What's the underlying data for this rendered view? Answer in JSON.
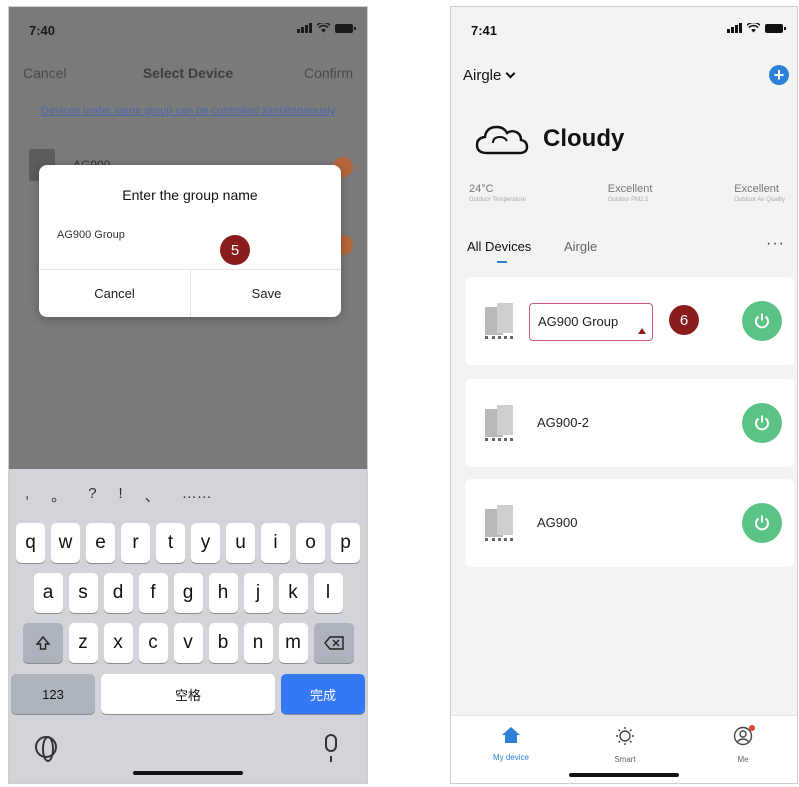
{
  "left": {
    "status": {
      "time": "7:40"
    },
    "nav": {
      "cancel": "Cancel",
      "title": "Select Device",
      "confirm": "Confirm"
    },
    "hint": "Devices under same group can be controlled simultaneously",
    "background_devices": [
      {
        "name": "AG900"
      }
    ],
    "dialog": {
      "title": "Enter the group name",
      "input_value": "AG900 Group",
      "cancel_label": "Cancel",
      "save_label": "Save"
    },
    "step_badge": "5",
    "keyboard": {
      "suggestions": [
        ",",
        "。",
        "?",
        "!",
        "、",
        "……"
      ],
      "row1": [
        "q",
        "w",
        "e",
        "r",
        "t",
        "y",
        "u",
        "i",
        "o",
        "p"
      ],
      "row2": [
        "a",
        "s",
        "d",
        "f",
        "g",
        "h",
        "j",
        "k",
        "l"
      ],
      "row3": [
        "z",
        "x",
        "c",
        "v",
        "b",
        "n",
        "m"
      ],
      "shift_icon": "shift-icon",
      "delete_icon": "backspace-icon",
      "numbers_label": "123",
      "space_label": "空格",
      "done_label": "完成",
      "globe_icon": "globe-icon",
      "mic_icon": "microphone-icon",
      "done_color": "#3478f6"
    }
  },
  "right": {
    "status": {
      "time": "7:41"
    },
    "app_name": "Airgle",
    "add_icon": "plus-icon",
    "weather": {
      "icon": "cloud-icon",
      "text": "Cloudy"
    },
    "metrics": [
      {
        "value": "24°C",
        "label": "Outdoor Temperature"
      },
      {
        "value": "Excellent",
        "label": "Outdoor PM2.5"
      },
      {
        "value": "Excellent",
        "label": "Outdoor Air Quality"
      }
    ],
    "tabs": {
      "all": "All Devices",
      "airgle": "Airgle",
      "more": "···"
    },
    "devices": [
      {
        "name": "AG900 Group"
      },
      {
        "name": "AG900-2"
      },
      {
        "name": "AG900"
      }
    ],
    "step_badge": "6",
    "accent": "#2d82d6",
    "power_color": "#5bc385",
    "tabbar": {
      "home": "My device",
      "smart": "Smart",
      "me": "Me"
    }
  }
}
